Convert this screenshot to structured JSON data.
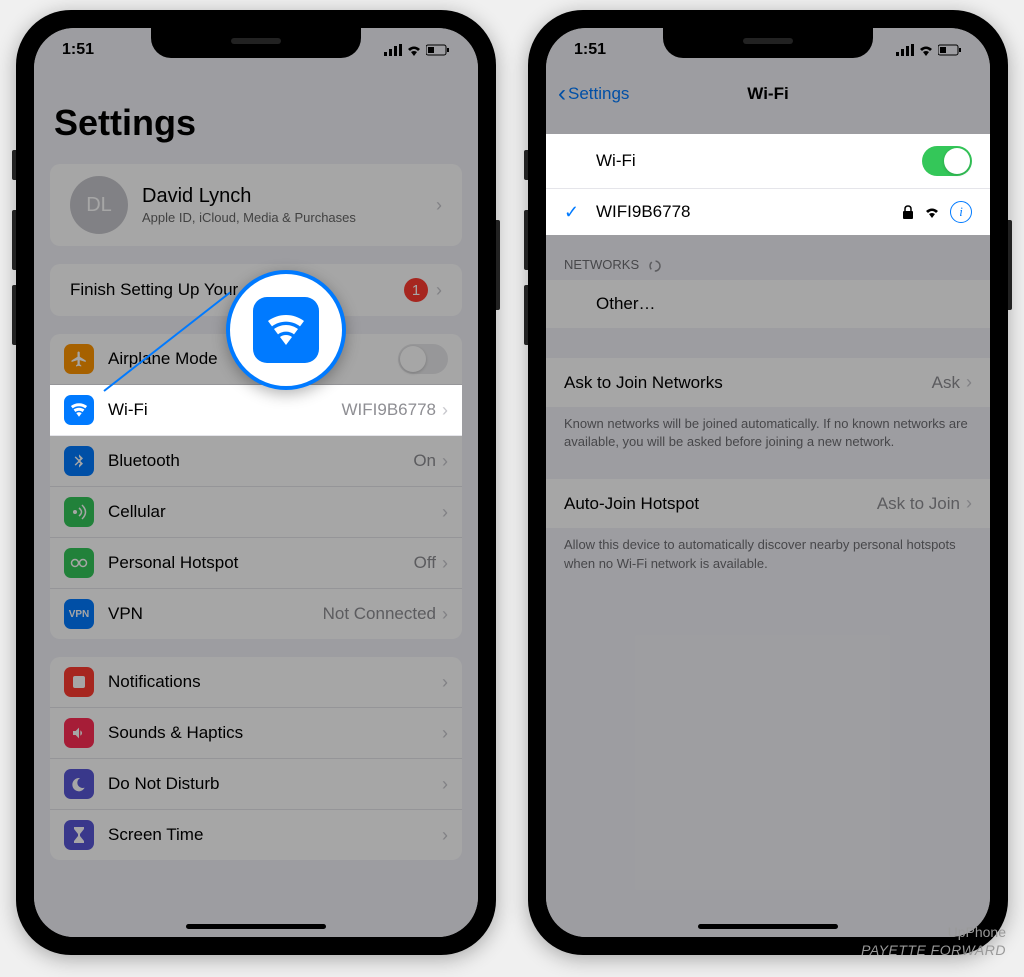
{
  "status": {
    "time": "1:51"
  },
  "left": {
    "title": "Settings",
    "account": {
      "initials": "DL",
      "name": "David Lynch",
      "sub": "Apple ID, iCloud, Media & Purchases"
    },
    "finish": {
      "label": "Finish Setting Up Your",
      "badge": "1"
    },
    "rows": {
      "airplane": {
        "label": "Airplane Mode"
      },
      "wifi": {
        "label": "Wi-Fi",
        "value": "WIFI9B6778"
      },
      "bluetooth": {
        "label": "Bluetooth",
        "value": "On"
      },
      "cellular": {
        "label": "Cellular"
      },
      "hotspot": {
        "label": "Personal Hotspot",
        "value": "Off"
      },
      "vpn": {
        "label": "VPN",
        "value": "Not Connected"
      },
      "notifications": {
        "label": "Notifications"
      },
      "sounds": {
        "label": "Sounds & Haptics"
      },
      "dnd": {
        "label": "Do Not Disturb"
      },
      "screentime": {
        "label": "Screen Time"
      }
    }
  },
  "right": {
    "back": "Settings",
    "title": "Wi-Fi",
    "toggle_label": "Wi-Fi",
    "connected": "WIFI9B6778",
    "networks_header": "NETWORKS",
    "other": "Other…",
    "ask_join": {
      "label": "Ask to Join Networks",
      "value": "Ask"
    },
    "ask_join_footer": "Known networks will be joined automatically. If no known networks are available, you will be asked before joining a new network.",
    "auto_hotspot": {
      "label": "Auto-Join Hotspot",
      "value": "Ask to Join"
    },
    "auto_hotspot_footer": "Allow this device to automatically discover nearby personal hotspots when no Wi-Fi network is available."
  },
  "watermark": {
    "line1": "UpPhone",
    "line2": "PAYETTE FORWARD"
  }
}
